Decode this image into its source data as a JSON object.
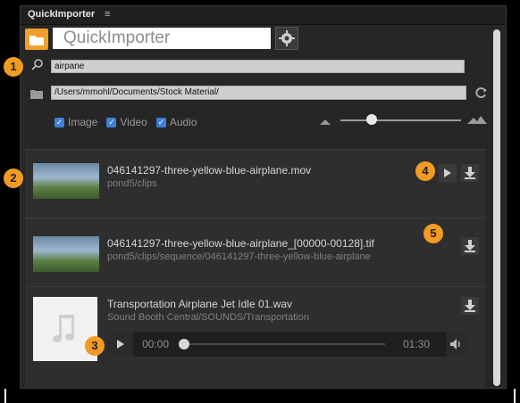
{
  "panel": {
    "title": "QuickImporter",
    "menu_icon": "hamburger-icon"
  },
  "header": {
    "app_name": "QuickImporter",
    "folder_icon": "folder-icon",
    "settings_icon": "gear-icon"
  },
  "search": {
    "value": "airpane",
    "icon": "search-icon"
  },
  "path": {
    "value": "/Users/mmohl/Documents/Stock Material/",
    "icon": "folder-icon",
    "refresh_icon": "refresh-icon"
  },
  "filters": [
    {
      "label": "Image",
      "checked": true
    },
    {
      "label": "Video",
      "checked": true
    },
    {
      "label": "Audio",
      "checked": true
    }
  ],
  "size_slider": {
    "level": 0.22
  },
  "items": [
    {
      "name": "046141297-three-yellow-blue-airplane.mov",
      "path": "pond5/clips"
    },
    {
      "name": "046141297-three-yellow-blue-airplane_[00000-00128].tif",
      "path": "pond5/clips/sequence/046141297-three-yellow-blue-airplane"
    },
    {
      "name": "Transportation Airplane Jet Idle 01.wav",
      "path": "Sound Booth Central/SOUNDS/Transportation",
      "thumb_icon": "music-note-icon",
      "player": {
        "current": "00:00",
        "duration": "01:30",
        "progress": 0.0
      }
    }
  ],
  "callouts": [
    "1",
    "2",
    "3",
    "4",
    "5"
  ],
  "colors": {
    "accent": "#f0a02a",
    "checkbox": "#3d7fd9",
    "panel_bg": "#262626"
  }
}
